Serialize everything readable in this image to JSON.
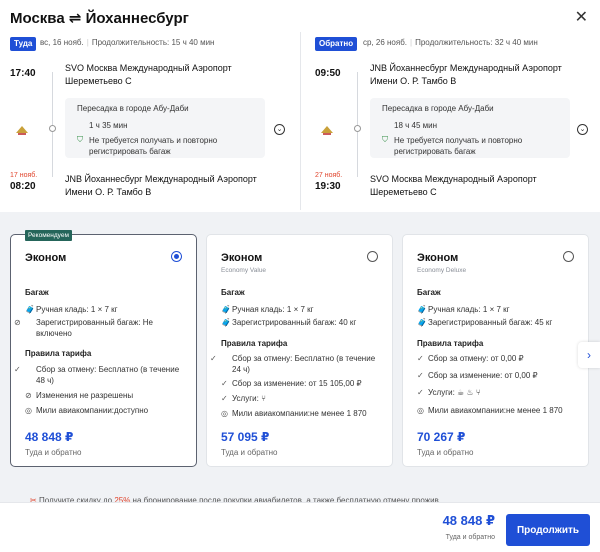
{
  "header": {
    "title": "Москва ⇌ Йоханнесбург",
    "close_glyph": "✕"
  },
  "outbound": {
    "pill": "Туда",
    "date": "вс, 16 нояб.",
    "duration": "Продолжительность: 15 ч 40 мин",
    "dep_time": "17:40",
    "dep_airport": "SVO Москва Международный Аэропорт Шереметьево С",
    "transfer_city": "Пересадка в городе Абу-Даби",
    "transfer_duration": "1 ч 35 мин",
    "transfer_note": "Не требуется получать и повторно регистрировать багаж",
    "arr_nextday": "17 нояб.",
    "arr_time": "08:20",
    "arr_airport": "JNB Йоханнесбург Международный Аэропорт Имени О. Р. Тамбо В"
  },
  "inbound": {
    "pill": "Обратно",
    "date": "ср, 26 нояб.",
    "duration": "Продолжительность: 32 ч 40 мин",
    "dep_time": "09:50",
    "dep_airport": "JNB Йоханнесбург Международный Аэропорт Имени О. Р. Тамбо В",
    "transfer_city": "Пересадка в городе Абу-Даби",
    "transfer_duration": "18 ч 45 мин",
    "transfer_note": "Не требуется получать и повторно регистрировать багаж",
    "arr_nextday": "27 нояб.",
    "arr_time": "19:30",
    "arr_airport": "SVO Москва Международный Аэропорт Шереметьево С"
  },
  "fares": [
    {
      "badge": "Рекомендуем",
      "name": "Эконом",
      "sub": "",
      "selected": true,
      "baggage_title": "Багаж",
      "baggage": [
        "Ручная кладь: 1 × 7 кг",
        "Зарегистрированный багаж: Не включено"
      ],
      "rules_title": "Правила тарифа",
      "rules": [
        "Сбор за отмену: Бесплатно (в течение 48 ч)",
        "Изменения не разрешены",
        "Мили авиакомпании:доступно"
      ],
      "price": "48 848 ₽",
      "price_note": "Туда и обратно"
    },
    {
      "badge": "",
      "name": "Эконом",
      "sub": "Economy Value",
      "selected": false,
      "baggage_title": "Багаж",
      "baggage": [
        "Ручная кладь: 1 × 7 кг",
        "Зарегистрированный багаж: 40 кг"
      ],
      "rules_title": "Правила тарифа",
      "rules": [
        "Сбор за отмену: Бесплатно (в течение 24 ч)",
        "Сбор за изменение: от 15 105,00 ₽",
        "Услуги:",
        "Мили авиакомпании:не менее 1 870"
      ],
      "price": "57 095 ₽",
      "price_note": "Туда и обратно"
    },
    {
      "badge": "",
      "name": "Эконом",
      "sub": "Economy Deluxe",
      "selected": false,
      "baggage_title": "Багаж",
      "baggage": [
        "Ручная кладь: 1 × 7 кг",
        "Зарегистрированный багаж: 45 кг"
      ],
      "rules_title": "Правила тарифа",
      "rules": [
        "Сбор за отмену: от 0,00 ₽",
        "Сбор за изменение: от 0,00 ₽",
        "Услуги:",
        "Мили авиакомпании:не менее 1 870"
      ],
      "price": "70 267 ₽",
      "price_note": "Туда и обратно"
    }
  ],
  "promo": {
    "before": "Получите скидку до ",
    "highlight": "25%",
    "after": " на бронирование после покупки авиабилетов, а также бесплатную отмену прожив..."
  },
  "footer": {
    "total": "48 848 ₽",
    "total_note": "Туда и обратно",
    "cta": "Продолжить"
  },
  "colors": {
    "accent": "#1f4fd6",
    "badge": "#25655a",
    "warning": "#e0442c"
  }
}
